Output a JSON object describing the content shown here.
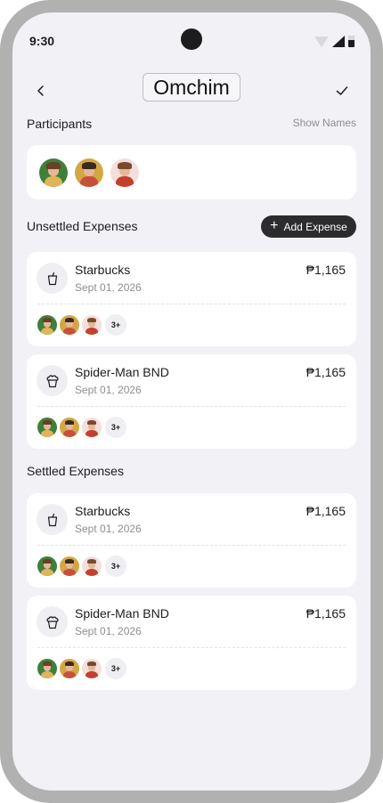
{
  "status_bar": {
    "time": "9:30"
  },
  "header": {
    "title": "Omchim"
  },
  "participants": {
    "title": "Participants",
    "show_names_label": "Show Names"
  },
  "unsettled": {
    "title": "Unsettled Expenses",
    "add_label": "Add Expense",
    "items": [
      {
        "name": "Starbucks",
        "date": "Sept 01, 2026",
        "amount": "₱1,165",
        "more": "3+",
        "icon": "cup-icon"
      },
      {
        "name": "Spider-Man BND",
        "date": "Sept 01, 2026",
        "amount": "₱1,165",
        "more": "3+",
        "icon": "popcorn-icon"
      }
    ]
  },
  "settled": {
    "title": "Settled Expenses",
    "items": [
      {
        "name": "Starbucks",
        "date": "Sept 01, 2026",
        "amount": "₱1,165",
        "more": "3+",
        "icon": "cup-icon"
      },
      {
        "name": "Spider-Man BND",
        "date": "Sept 01, 2026",
        "amount": "₱1,165",
        "more": "3+",
        "icon": "popcorn-icon"
      }
    ]
  },
  "colors": {
    "accent": "#2c2c2e",
    "background": "#f2f1f6",
    "card": "#ffffff",
    "muted": "#8e8e93"
  }
}
